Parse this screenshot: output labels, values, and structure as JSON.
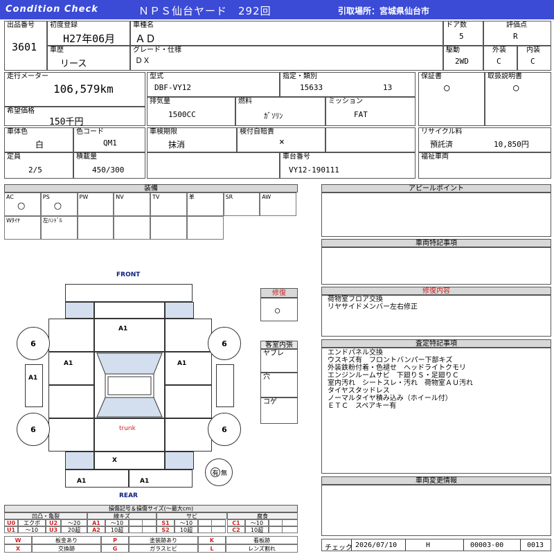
{
  "header": {
    "brand": "Condition Check",
    "auction": "ＮＰＳ仙台ヤード　292回",
    "pickup": "引取場所：宮城県仙台市"
  },
  "listing": {
    "lot_label": "出品番号",
    "lot": "3601",
    "first_reg_label": "初度登録",
    "first_reg": "H27年06月",
    "name_label": "車種名",
    "name": "ＡＤ",
    "doors_label": "ドア数",
    "doors": "5",
    "grade_score_label": "評価点",
    "grade_score": "R",
    "history_label": "車歴",
    "history": "リース",
    "grade_label": "グレード・仕様",
    "grade": "ＤＸ",
    "drive_label": "駆動",
    "drive": "2WD",
    "ext_label": "外装",
    "ext": "C",
    "int_label": "内装",
    "int": "C"
  },
  "specs": {
    "mileage_label": "走行メーター",
    "mileage": "106,579km",
    "price_label": "希望価格",
    "price": "150千円",
    "model_label": "型式",
    "model": "DBF-VY12",
    "type_label": "指定・類別",
    "type_a": "15633",
    "type_b": "13",
    "warranty_label": "保証書",
    "warranty": "○",
    "manual_label": "取扱説明書",
    "manual": "○",
    "disp_label": "排気量",
    "disp": "1500CC",
    "fuel_label": "燃料",
    "fuel": "ｶﾞｿﾘﾝ",
    "mission_label": "ミッション",
    "mission": "FAT",
    "color_label": "車体色",
    "color": "白",
    "color_code_label": "色コード",
    "color_code": "QM1",
    "inspection_label": "車検期限",
    "inspection": "抹消",
    "insurance_label": "検付自賠責",
    "insurance": "×",
    "recycle_label": "リサイクル料",
    "recycle_status": "預託済",
    "recycle_amount": "10,850円",
    "capacity_label": "定員",
    "capacity": "2/5",
    "load_label": "積載量",
    "load": "450/300",
    "chassis_label": "車台番号",
    "chassis": "VY12-190111",
    "welfare_label": "福祉車両"
  },
  "equipment": {
    "title": "装備",
    "row1": [
      {
        "label": "AC",
        "value": "○"
      },
      {
        "label": "PS",
        "value": "○"
      },
      {
        "label": "PW",
        "value": ""
      },
      {
        "label": "NV",
        "value": ""
      },
      {
        "label": "TV",
        "value": ""
      },
      {
        "label": "革",
        "value": ""
      },
      {
        "label": "SR",
        "value": ""
      },
      {
        "label": "AW",
        "value": ""
      }
    ],
    "row2": [
      {
        "label": "Wﾀｲﾔ",
        "value": ""
      },
      {
        "label": "左ﾊﾝﾄﾞﾙ",
        "value": ""
      },
      {
        "label": "",
        "value": ""
      },
      {
        "label": "",
        "value": ""
      },
      {
        "label": "",
        "value": ""
      },
      {
        "label": "",
        "value": ""
      }
    ]
  },
  "diagram": {
    "front": "FRONT",
    "rear": "REAR",
    "trunk": "trunk",
    "tires": [
      "6",
      "6",
      "6",
      "6"
    ],
    "marks": {
      "roof": "A1",
      "left_front": "A1",
      "right_front": "A1",
      "left_side": "A1",
      "rear_center": "X",
      "rear_left": "A1",
      "rear_right": "A1"
    },
    "spare_label": "有",
    "spare_none": "無"
  },
  "repair": {
    "title": "修復",
    "value": "○"
  },
  "cabin": {
    "title": "客室内張",
    "items": [
      "ヤブレ",
      "穴",
      "コゲ"
    ]
  },
  "appeal": {
    "title": "アピールポイント"
  },
  "notes": {
    "title": "車両特記事項"
  },
  "repair_content": {
    "title": "修復内容",
    "lines": [
      "荷物室フロア交換",
      "リヤサイドメンバー左右修正"
    ]
  },
  "inspection_notes": {
    "title": "査定特記事項",
    "lines": [
      "エンドパネル交換",
      "ウスキズ有　フロントバンパー下部キズ",
      "外装鉄粉付着・色褪せ　ヘッドライトクモリ",
      "エンジンルームサビ　下廻りＳ・足廻りＣ",
      "室内汚れ　シートスレ・汚れ　荷物室ＡＵ汚れ",
      "タイヤスタッドレス",
      "ノーマルタイヤ積み込み（ホイール付）",
      "ＥＴＣ　スペアキー有"
    ]
  },
  "changes": {
    "title": "車両変更情報"
  },
  "legend": {
    "title": "損傷記号＆損傷サイズ(〜最大cm)",
    "groups": [
      {
        "name": "凹凸・亀裂",
        "rows": [
          [
            "U0",
            "エクボ",
            "U2",
            "〜20"
          ],
          [
            "U1",
            "〜10",
            "U3",
            "20超"
          ]
        ]
      },
      {
        "name": "線キズ",
        "rows": [
          [
            "A1",
            "〜10"
          ],
          [
            "A2",
            "10超"
          ]
        ]
      },
      {
        "name": "サビ",
        "rows": [
          [
            "S1",
            "〜10"
          ],
          [
            "S2",
            "10超"
          ]
        ]
      },
      {
        "name": "腐食",
        "rows": [
          [
            "C1",
            "〜10"
          ],
          [
            "C2",
            "10超"
          ]
        ]
      }
    ],
    "row1": [
      [
        "W",
        "板金あり"
      ],
      [
        "P",
        "塗装跡あり"
      ],
      [
        "K",
        "看板跡"
      ]
    ],
    "row2": [
      [
        "X",
        "交換跡"
      ],
      [
        "G",
        "ガラスヒビ"
      ],
      [
        "L",
        "レンズ割れ"
      ]
    ]
  },
  "footer": {
    "check_label": "チェック",
    "date": "2026/07/10",
    "mark": "H",
    "code1": "00003-00",
    "code2": "0013"
  },
  "colors": {
    "header_bg": "#3b4bd6",
    "accent_red": "#d21f1f",
    "navy": "#0a1e7a",
    "panel_blue": "#d3dfee"
  }
}
